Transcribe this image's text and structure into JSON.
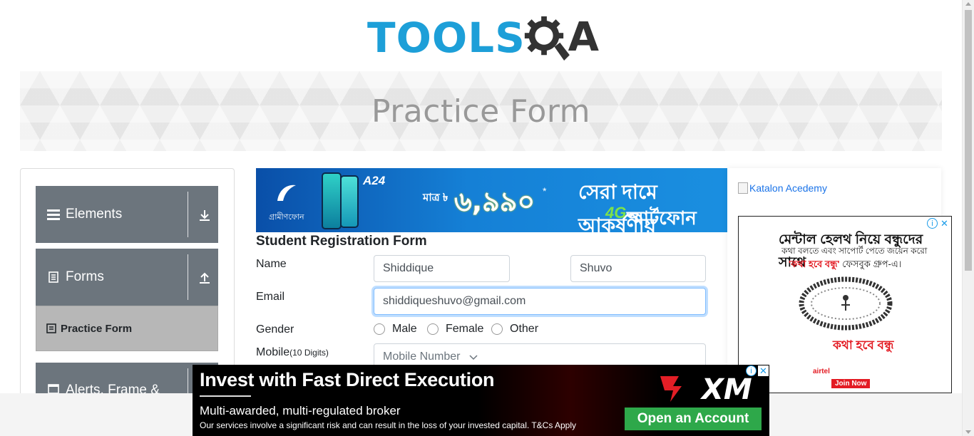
{
  "header": {
    "logo_text": "TOOLS",
    "logo_suffix": "A"
  },
  "banner": {
    "title": "Practice Form"
  },
  "sidebar": {
    "groups": [
      {
        "label": "Elements",
        "icon": "hamburger-icon",
        "toggle": "download-arrow-icon"
      },
      {
        "label": "Forms",
        "icon": "document-icon",
        "toggle": "upload-arrow-icon"
      },
      {
        "label": "Alerts, Frame & Windows",
        "icon": "window-icon"
      }
    ],
    "active_item": {
      "label": "Practice Form",
      "icon": "form-icon"
    }
  },
  "ad_top": {
    "brand": "গ্রামীণফোন",
    "phone_model": "A24",
    "price_label": "মাত্র ৳",
    "price": "৬,৯৯০",
    "price_star": "*",
    "slogan_line1": "সেরা দামে আকর্ষণীয়",
    "network": "4G",
    "slogan_line2": "স্মার্টফোন"
  },
  "form": {
    "title": "Student Registration Form",
    "labels": {
      "name": "Name",
      "email": "Email",
      "gender": "Gender",
      "mobile": "Mobile",
      "mobile_hint": "(10 Digits)"
    },
    "first_name": "Shiddique",
    "last_name": "Shuvo",
    "email": "shiddiqueshuvo@gmail.com",
    "mobile_placeholder": "Mobile Number",
    "gender_options": [
      "Male",
      "Female",
      "Other"
    ]
  },
  "right_panel": {
    "katalon_link": "Katalon Acedemy",
    "ad": {
      "headline": "মেন্টাল হেলথ নিয়ে বন্ধুদের সাথে",
      "line2": "কথা বলতে এবং সাপোর্ট পেতে জয়েন করো",
      "line3_highlight": "'কথা হবে বন্ধু'",
      "line3_rest": "ফেসবুক গ্রুপ-এ।",
      "tagline": "কথা হবে বন্ধু",
      "brand": "airtel",
      "cta": "Join Now"
    }
  },
  "ad_bottom": {
    "headline": "Invest with Fast Direct Execution",
    "subhead": "Multi-awarded, multi-regulated broker",
    "disclaimer": "Our services involve a significant risk and can result in the loss of your invested capital. T&Cs Apply",
    "brand": "XM",
    "cta": "Open an Account"
  },
  "colors": {
    "accent_blue": "#1d9fd8",
    "sidebar_gray": "#6c757d",
    "active_item_gray": "#b7b7b7",
    "xm_green": "#2ea84a",
    "xm_red": "#e21e26"
  }
}
